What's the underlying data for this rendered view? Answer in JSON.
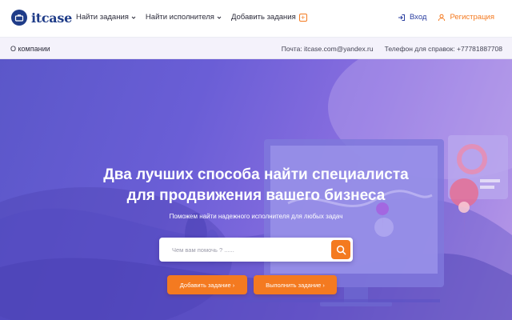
{
  "brand": {
    "name": "itcase"
  },
  "nav": {
    "items": [
      {
        "label": "Найти задания",
        "has_dropdown": true
      },
      {
        "label": "Найти исполнителя",
        "has_dropdown": true
      },
      {
        "label": "Добавить задания",
        "has_plus": true
      }
    ],
    "login_label": "Вход",
    "register_label": "Регистрация"
  },
  "subbar": {
    "about_label": "О компании",
    "email_text": "Почта: itcase.com@yandex.ru",
    "phone_text": "Телефон для справок: +77781887708"
  },
  "hero": {
    "title_line1": "Два лучших способа найти специалиста",
    "title_line2": "для продвижения вашего бизнеса",
    "subtitle": "Поможем найти надежного исполнителя для любых задач",
    "search_placeholder": "Чем вам помочь ? ......",
    "btn_add_label": "Добавить задание ›",
    "btn_do_label": "Выполнить задание ›"
  },
  "colors": {
    "brand_blue": "#1f3c88",
    "accent_orange": "#f47a20",
    "hero_purple": "#6a5ed6"
  },
  "icons": [
    "briefcase-icon",
    "chevron-down-icon",
    "plus-square-icon",
    "login-icon",
    "user-icon",
    "search-icon"
  ]
}
